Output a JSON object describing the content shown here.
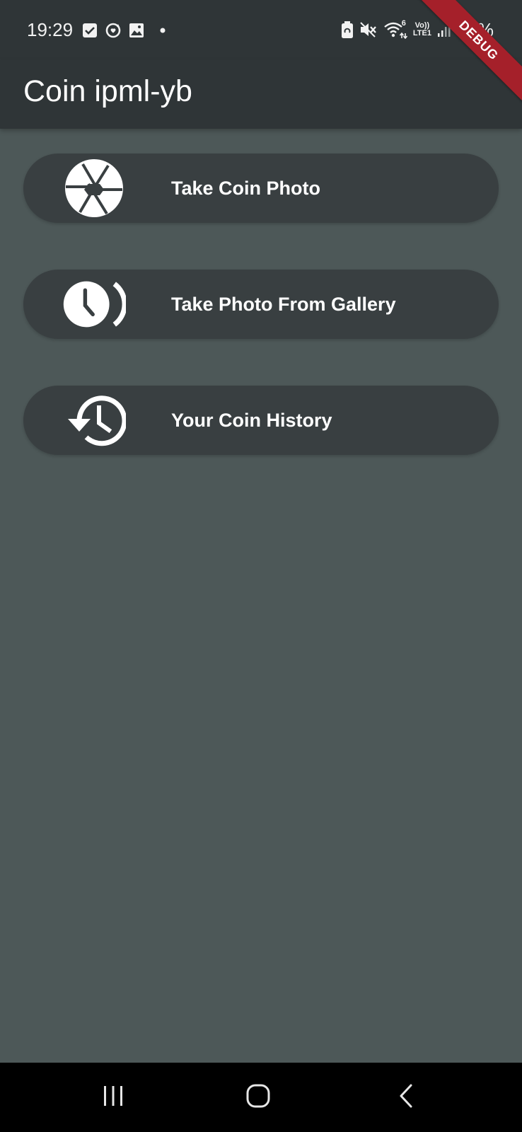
{
  "status_bar": {
    "time": "19:29",
    "network_top": "Vo))",
    "network_bottom": "LTE1",
    "wifi_label": "6",
    "battery": "15%",
    "icons": [
      "checkbox-icon",
      "sync-heart-icon",
      "image-icon",
      "dot-icon",
      "battery-saver-icon",
      "mute-icon",
      "wifi-icon",
      "signal-icon"
    ]
  },
  "app_bar": {
    "title": "Coin ipml-yb"
  },
  "debug_banner": {
    "label": "DEBUG",
    "color": "#a5202a"
  },
  "menu": {
    "items": [
      {
        "label": "Take Coin Photo",
        "icon": "camera-aperture-icon"
      },
      {
        "label": "Take Photo From Gallery",
        "icon": "clock-gallery-icon"
      },
      {
        "label": "Your Coin History",
        "icon": "history-icon"
      }
    ]
  },
  "nav_bar": {
    "buttons": [
      "recents-icon",
      "home-icon",
      "back-icon"
    ]
  },
  "colors": {
    "background": "#4d5858",
    "app_bar": "#2f3537",
    "button": "#393f41",
    "text": "#ffffff"
  }
}
